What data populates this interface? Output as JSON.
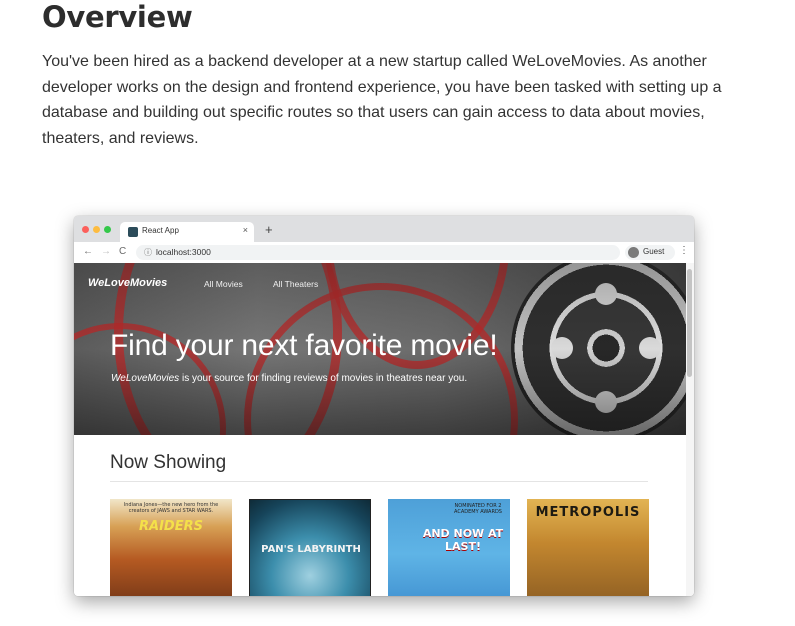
{
  "doc": {
    "title": "Overview",
    "paragraph": "You've been hired as a backend developer at a new startup called WeLoveMovies. As another developer works on the design and frontend experience, you have been tasked with setting up a database and building out specific routes so that users can gain access to data about movies, theaters, and reviews."
  },
  "browser": {
    "tab_title": "React App",
    "tab_close": "×",
    "new_tab": "+",
    "back": "←",
    "forward": "→",
    "reload": "C",
    "lock": "ⓘ",
    "url": "localhost:3000",
    "profile_label": "Guest",
    "menu": "⋮"
  },
  "site": {
    "brand": "WeLoveMovies",
    "nav": [
      "All Movies",
      "All Theaters"
    ],
    "hero_heading": "Find your next favorite movie!",
    "hero_subtitle_brand": "WeLoveMovies",
    "hero_subtitle_rest": " is your source for finding reviews of movies in theatres near you.",
    "section_title": "Now Showing",
    "posters": [
      {
        "title": "RAIDERS",
        "tag": "Indiana Jones—the new hero from the creators of JAWS and STAR WARS."
      },
      {
        "title": "PAN'S LABYRINTH"
      },
      {
        "title": "AND NOW AT LAST!",
        "tag": "NOMINATED FOR 2 ACADEMY AWARDS"
      },
      {
        "title": "METROPOLIS"
      }
    ]
  },
  "colors": {
    "accent_red": "#c42424",
    "tab_bar": "#dedfe1"
  }
}
